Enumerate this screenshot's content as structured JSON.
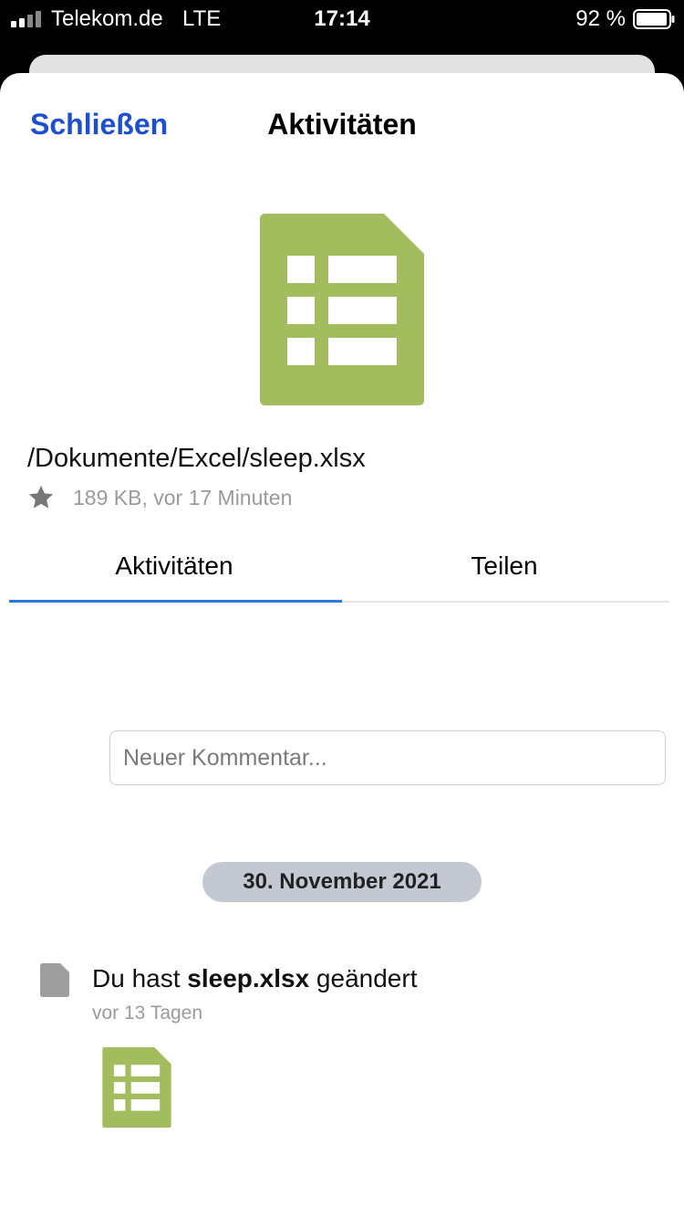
{
  "status_bar": {
    "carrier": "Telekom.de",
    "network": "LTE",
    "time": "17:14",
    "battery_percent": "92 %"
  },
  "header": {
    "close_label": "Schließen",
    "title": "Aktivitäten"
  },
  "file": {
    "path": "/Dokumente/Excel/sleep.xlsx",
    "meta": "189 KB, vor 17 Minuten",
    "icon": "spreadsheet-icon",
    "icon_color": "#a3bd5e"
  },
  "tabs": [
    {
      "label": "Aktivitäten",
      "active": true
    },
    {
      "label": "Teilen",
      "active": false
    }
  ],
  "comment": {
    "placeholder": "Neuer Kommentar..."
  },
  "activity": {
    "date": "30. November 2021",
    "items": [
      {
        "prefix": "Du hast ",
        "filename": "sleep.xlsx",
        "suffix": " geändert",
        "time": "vor 13 Tagen",
        "icon": "document-icon"
      }
    ]
  },
  "colors": {
    "accent": "#1e4fcf",
    "tab_indicator": "#2e7bd6",
    "chip_bg": "#c3c8d2"
  }
}
